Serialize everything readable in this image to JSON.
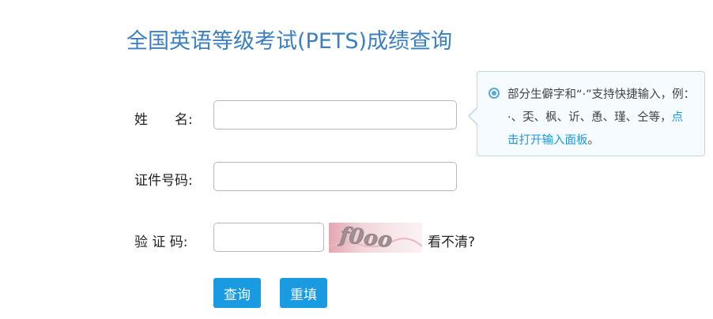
{
  "page": {
    "title": "全国英语等级考试(PETS)成绩查询"
  },
  "form": {
    "name_label": "姓　　名:",
    "name_value": "",
    "id_label": "证件号码:",
    "id_value": "",
    "captcha_label": "验 证 码:",
    "captcha_value": "",
    "captcha_text": "f0oo",
    "captcha_refresh": "看不清?"
  },
  "buttons": {
    "query": "查询",
    "reset": "重填"
  },
  "tooltip": {
    "text": "部分生僻字和“·”支持快捷输入，例：·、奀、枫、䜣、恿、瑾、仝等，",
    "link": "点击打开输入面板",
    "end": "。"
  },
  "colors": {
    "title": "#3a7fc1",
    "button": "#1a9ae0",
    "link": "#1a9ae0"
  }
}
